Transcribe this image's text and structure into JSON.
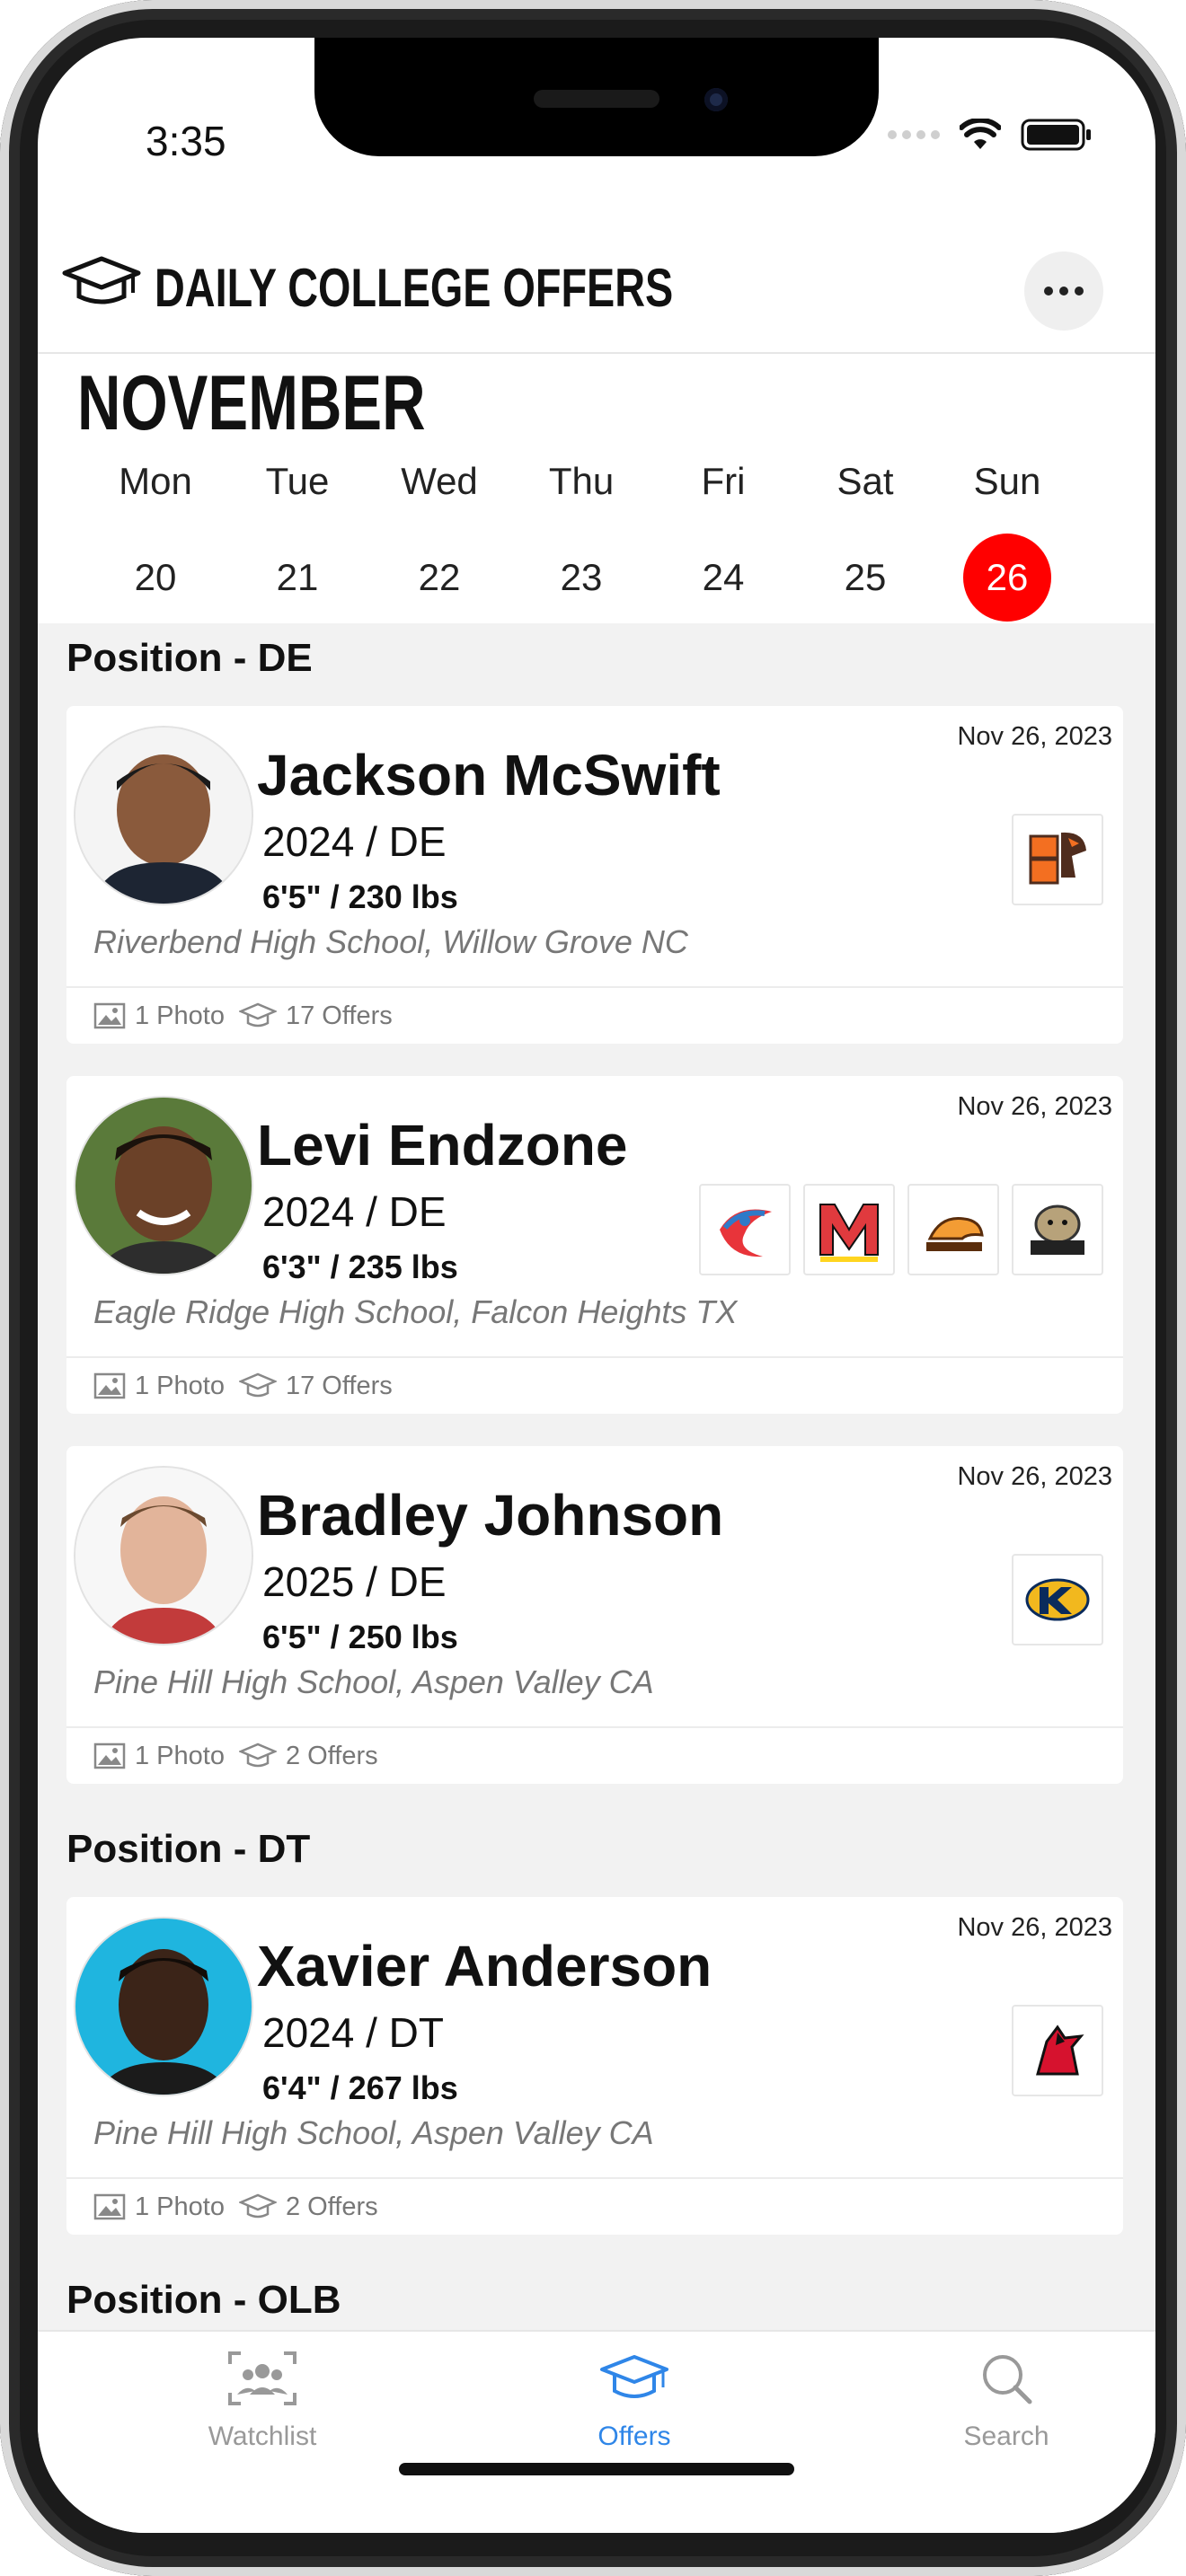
{
  "status": {
    "time": "3:35"
  },
  "header": {
    "title": "DAILY COLLEGE OFFERS"
  },
  "calendar": {
    "month": "NOVEMBER",
    "days": [
      {
        "dow": "Mon",
        "num": "20"
      },
      {
        "dow": "Tue",
        "num": "21"
      },
      {
        "dow": "Wed",
        "num": "22"
      },
      {
        "dow": "Thu",
        "num": "23"
      },
      {
        "dow": "Fri",
        "num": "24"
      },
      {
        "dow": "Sat",
        "num": "25"
      },
      {
        "dow": "Sun",
        "num": "26"
      }
    ],
    "selected_day": "26"
  },
  "sections": [
    {
      "title": "Position - DE"
    },
    {
      "title": "Position - DT"
    },
    {
      "title": "Position - OLB"
    }
  ],
  "players": [
    {
      "name": "Jackson McSwift",
      "class_pos": "2024 / DE",
      "ht_wt": "6'5\" / 230 lbs",
      "school": "Riverbend High School, Willow Grove NC",
      "date": "Nov 26, 2023",
      "photos": "1 Photo",
      "offers": "17 Offers"
    },
    {
      "name": "Levi Endzone",
      "class_pos": "2024 / DE",
      "ht_wt": "6'3\" / 235 lbs",
      "school": "Eagle Ridge High School, Falcon Heights TX",
      "date": "Nov 26, 2023",
      "photos": "1 Photo",
      "offers": "17 Offers"
    },
    {
      "name": "Bradley Johnson",
      "class_pos": "2025 / DE",
      "ht_wt": "6'5\" / 250 lbs",
      "school": "Pine Hill High School, Aspen Valley CA",
      "date": "Nov 26, 2023",
      "photos": "1 Photo",
      "offers": "2 Offers"
    },
    {
      "name": "Xavier Anderson",
      "class_pos": "2024 / DT",
      "ht_wt": "6'4\" / 267 lbs",
      "school": "Pine Hill High School, Aspen Valley CA",
      "date": "Nov 26, 2023",
      "photos": "1 Photo",
      "offers": "2 Offers"
    }
  ],
  "tabs": [
    {
      "label": "Watchlist",
      "icon": "watchlist-icon"
    },
    {
      "label": "Offers",
      "icon": "graduation-cap-icon"
    },
    {
      "label": "Search",
      "icon": "search-icon"
    }
  ],
  "colors": {
    "accent_red": "#ff0000",
    "tab_active": "#2f86e8"
  }
}
